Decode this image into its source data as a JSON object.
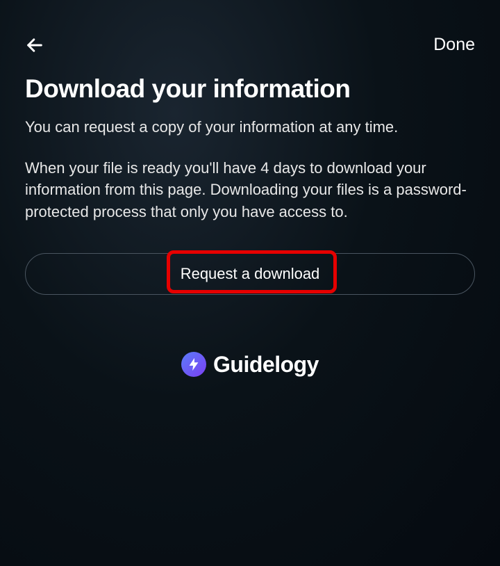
{
  "header": {
    "done_label": "Done"
  },
  "page": {
    "title": "Download your information",
    "description1": "You can request a copy of your information at any time.",
    "description2": "When your file is ready you'll have 4 days to download your information from this page. Downloading your files is a password-protected process that only you have access to.",
    "request_button_label": "Request a download"
  },
  "watermark": {
    "text": "Guidelogy"
  }
}
